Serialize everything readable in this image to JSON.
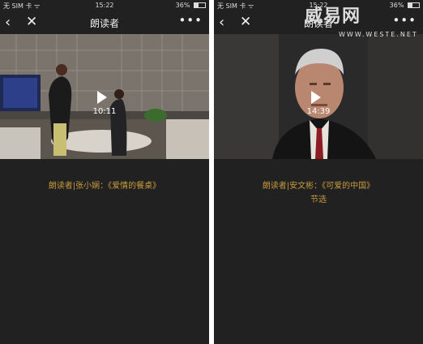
{
  "left": {
    "status": {
      "carrier": "无 SIM 卡 ᯤ",
      "time": "15:22",
      "battery": "36%"
    },
    "nav": {
      "back": "‹",
      "close": "✕",
      "title": "朗读者",
      "more": "•••"
    },
    "video": {
      "duration": "10:11"
    },
    "caption": "朗读者|张小娴：《爱情的餐桌》"
  },
  "right": {
    "status": {
      "carrier": "无 SIM 卡 ᯤ",
      "time": "15:22",
      "battery": "36%"
    },
    "nav": {
      "back": "‹",
      "close": "✕",
      "title": "朗读者",
      "more": "•••"
    },
    "video": {
      "duration": "14:39"
    },
    "caption_line1": "朗读者|安文彬：《可爱的中国》",
    "caption_line2": "节选"
  },
  "watermark": {
    "text": "威易网",
    "url": "WWW.WESTE.NET"
  }
}
